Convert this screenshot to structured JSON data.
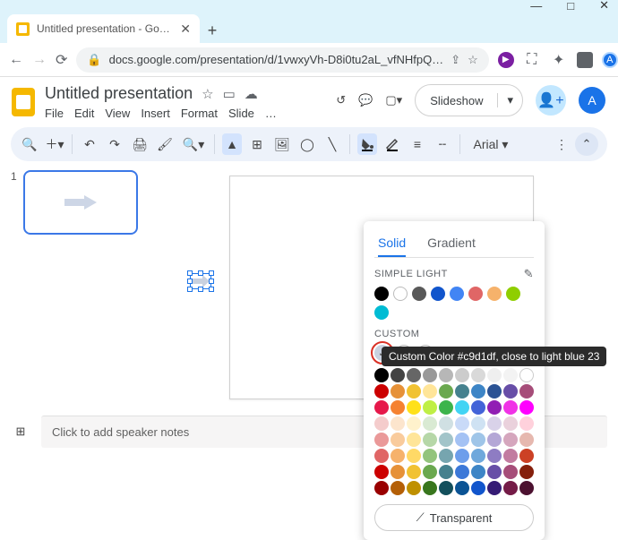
{
  "browser": {
    "tab_title": "Untitled presentation - Google S",
    "url": "docs.google.com/presentation/d/1vwxyVh-D8i0tu2aL_vfNHfpQ…",
    "avatar_letter": "A"
  },
  "doc": {
    "title": "Untitled presentation",
    "menus": [
      "File",
      "Edit",
      "View",
      "Insert",
      "Format",
      "Slide",
      "…"
    ]
  },
  "header": {
    "slideshow_label": "Slideshow",
    "avatar_letter": "A"
  },
  "toolbar": {
    "font": "Arial"
  },
  "thumbs": {
    "slide1_number": "1"
  },
  "notes": {
    "placeholder": "Click to add speaker notes"
  },
  "fill_popup": {
    "tabs": {
      "solid": "Solid",
      "gradient": "Gradient"
    },
    "simple_light_label": "SIMPLE LIGHT",
    "simple_light_colors": [
      "#000000",
      "#ffffff",
      "#595959",
      "#1155cc",
      "#4285f4",
      "#e06666",
      "#f6b26b",
      "#8fce00",
      "#00bcd4"
    ],
    "custom_label": "CUSTOM",
    "custom_color": "#c9d1df",
    "tooltip": "Custom Color #c9d1df, close to light blue 23",
    "grid_colors": [
      "#000000",
      "#434343",
      "#666666",
      "#999999",
      "#b7b7b7",
      "#cccccc",
      "#d9d9d9",
      "#efefef",
      "#f3f3f3",
      "#ffffff",
      "#cc0000",
      "#e69138",
      "#f1c232",
      "#ffe599",
      "#6aa84f",
      "#45818e",
      "#3d85c6",
      "#2b5394",
      "#674ea7",
      "#a64d79",
      "#e6194b",
      "#f58231",
      "#ffe119",
      "#bfef45",
      "#3cb44b",
      "#42d4f4",
      "#4363d8",
      "#911eb4",
      "#f032e6",
      "#ff00ff",
      "#f4cccc",
      "#fce5cd",
      "#fff2cc",
      "#d9ead3",
      "#d0e0e3",
      "#c9daf8",
      "#cfe2f3",
      "#d9d2e9",
      "#ead1dc",
      "#ffd1dc",
      "#ea9999",
      "#f9cb9c",
      "#ffe599",
      "#b6d7a8",
      "#a2c4c9",
      "#a4c2f4",
      "#9fc5e8",
      "#b4a7d6",
      "#d5a6bd",
      "#e6b8af",
      "#e06666",
      "#f6b26b",
      "#ffd966",
      "#93c47d",
      "#76a5af",
      "#6d9eeb",
      "#6fa8dc",
      "#8e7cc3",
      "#c27ba0",
      "#cc4125",
      "#cc0000",
      "#e69138",
      "#f1c232",
      "#6aa84f",
      "#45818e",
      "#3c78d8",
      "#3d85c6",
      "#674ea7",
      "#a64d79",
      "#85200c",
      "#990000",
      "#b45f06",
      "#bf9000",
      "#38761d",
      "#134f5c",
      "#0b5394",
      "#1155cc",
      "#351c75",
      "#741b47",
      "#4c1130"
    ],
    "transparent_label": "Transparent"
  }
}
